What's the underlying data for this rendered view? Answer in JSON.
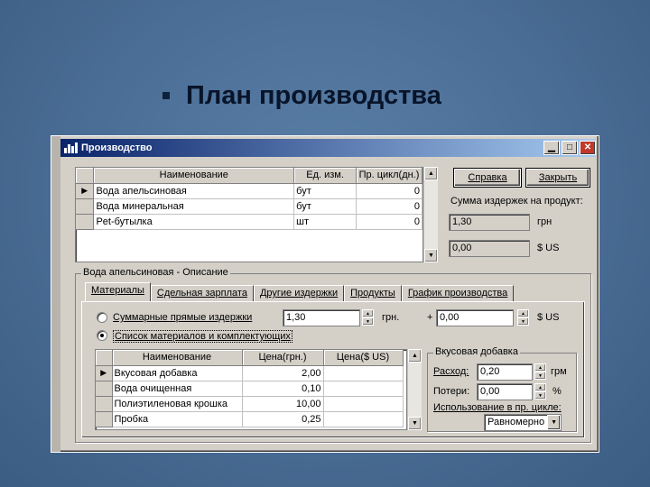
{
  "slide": {
    "title": "План производства"
  },
  "window": {
    "title": "Производство"
  },
  "top_grid": {
    "columns": [
      "Наименование",
      "Ед. изм.",
      "Пр. цикл(дн.)"
    ],
    "rows": [
      {
        "name": "Вода апельсиновая",
        "unit": "бут",
        "cycle": "0"
      },
      {
        "name": "Вода минеральная",
        "unit": "бут",
        "cycle": "0"
      },
      {
        "name": "Pet-бутылка",
        "unit": "шт",
        "cycle": "0"
      }
    ]
  },
  "buttons": {
    "help": "Справка",
    "close": "Закрыть"
  },
  "cost_panel": {
    "label": "Сумма издержек на продукт:",
    "value_uah": "1,30",
    "unit_uah": "грн",
    "value_usd": "0,00",
    "unit_usd": "$ US"
  },
  "description_group": {
    "title": "Вода апельсиновая - Описание"
  },
  "tabs": [
    {
      "label": "Материалы",
      "active": true
    },
    {
      "label": "Сдельная зарплата",
      "active": false
    },
    {
      "label": "Другие издержки",
      "active": false
    },
    {
      "label": "Продукты",
      "active": false
    },
    {
      "label": "График производства",
      "active": false
    }
  ],
  "materials": {
    "radio_total_label": "Суммарные прямые издержки",
    "total_value": "1,30",
    "total_unit": "грн.",
    "plus": "+",
    "usd_value": "0,00",
    "usd_unit": "$ US",
    "radio_list_label": "Список материалов и комплектующих",
    "selected_radio": "list",
    "columns": [
      "Наименование",
      "Цена(грн.)",
      "Цена($ US)"
    ],
    "rows": [
      {
        "name": "Вкусовая добавка",
        "price_uah": "2,00",
        "price_usd": ""
      },
      {
        "name": "Вода очищенная",
        "price_uah": "0,10",
        "price_usd": ""
      },
      {
        "name": "Полиэтиленовая крошка",
        "price_uah": "10,00",
        "price_usd": ""
      },
      {
        "name": "Пробка",
        "price_uah": "0,25",
        "price_usd": ""
      }
    ]
  },
  "additive_group": {
    "title": "Вкусовая добавка",
    "consumption_label": "Расход:",
    "consumption_value": "0,20",
    "consumption_unit": "грм",
    "losses_label": "Потери:",
    "losses_value": "0,00",
    "losses_unit": "%",
    "usage_label": "Использование в пр. цикле:",
    "usage_value": "Равномерно"
  },
  "colors": {
    "slide_bg": "#4a6d95",
    "titlebar": "#0a246a",
    "window_bg": "#d4d0c8"
  }
}
